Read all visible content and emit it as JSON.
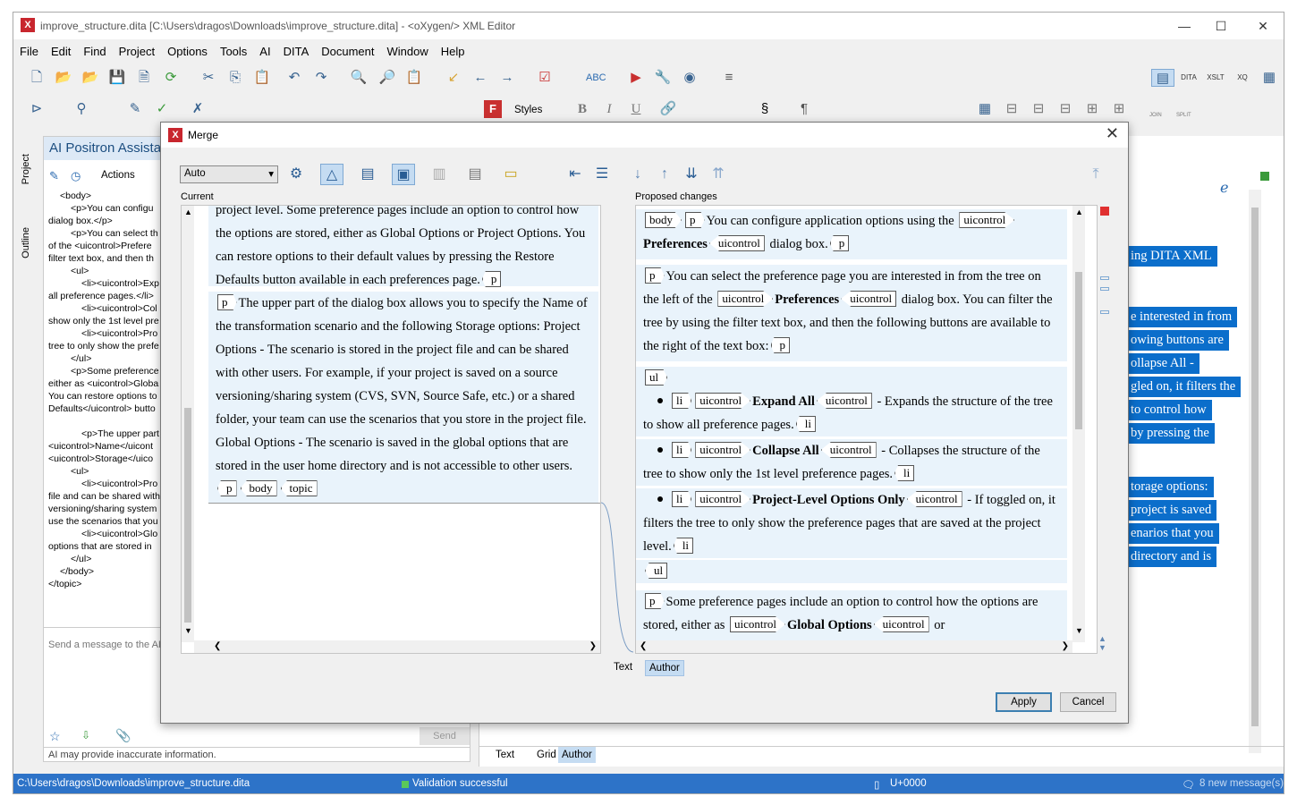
{
  "window": {
    "title": "improve_structure.dita [C:\\Users\\dragos\\Downloads\\improve_structure.dita] - <oXygen/> XML Editor",
    "logo": "X"
  },
  "menu": [
    "File",
    "Edit",
    "Find",
    "Project",
    "Options",
    "Tools",
    "AI",
    "DITA",
    "Document",
    "Window",
    "Help"
  ],
  "toolbar": {
    "styles_label": "Styles",
    "join_label": "JOIN",
    "split_label": "SPLIT"
  },
  "side_tabs": {
    "project": "Project",
    "outline": "Outline"
  },
  "ai_panel": {
    "title": "AI Positron Assista",
    "actions_label": "Actions",
    "xml_lines": [
      "<body>",
      "<p>You can configu",
      "dialog box.</p>",
      "<p>You can select th",
      "of the <uicontrol>Prefere",
      "filter text box, and then th",
      "<ul>",
      "<li><uicontrol>Exp",
      "all preference pages.</li>",
      "<li><uicontrol>Col",
      "show only the 1st level pre",
      "<li><uicontrol>Pro",
      "tree to only show the prefe",
      "</ul>",
      "<p>Some preference",
      "either as <uicontrol>Globa",
      "You can restore options to",
      "Defaults</uicontrol> butto",
      "",
      "<p>The upper part o",
      "<uicontrol>Name</uicont",
      "<uicontrol>Storage</uico",
      "<ul>",
      "<li><uicontrol>Pro",
      "file and can be shared with",
      "versioning/sharing system",
      "use the scenarios that you",
      "<li><uicontrol>Glo",
      "options that are stored in",
      "</ul>",
      "</body>",
      "</topic>"
    ],
    "input_placeholder": "Send a message to the AI",
    "send_label": "Send",
    "disclaimer": "AI may provide inaccurate information."
  },
  "editor": {
    "highlight_lines": [
      "ing DITA XML",
      "e interested in from",
      "owing buttons are",
      "ollapse All -",
      "gled on, it filters the",
      "to control how",
      "by pressing the",
      "torage options:",
      "project is saved",
      "enarios that you",
      "directory and is"
    ],
    "bottom_tabs": [
      "Text",
      "Grid",
      "Author"
    ],
    "active_tab": "Author"
  },
  "status": {
    "path": "C:\\Users\\dragos\\Downloads\\improve_structure.dita",
    "validation": "Validation successful",
    "unicode": "U+0000",
    "messages": "8 new message(s)"
  },
  "dialog": {
    "title": "Merge",
    "mode": "Auto",
    "current_label": "Current",
    "proposed_label": "Proposed changes",
    "current": {
      "top_text": "project level. Some preference pages include an option to control how the options are stored, either as Global Options or Project Options. You can restore options to their default values by pressing the Restore Defaults button available in each preferences page.",
      "para2": "The upper part of the dialog box allows you to specify the Name of the transformation scenario and the following Storage options: Project Options - The scenario is stored in the project file and can be shared with other users. For example, if your project is saved on a source versioning/sharing system (CVS, SVN, Source Safe, etc.) or a shared folder, your team can use the scenarios that you store in the project file. Global Options - The scenario is saved in the global options that are stored in the user home directory and is not accessible to other users."
    },
    "proposed": {
      "p1a": "You can configure application options using the",
      "p1b": "Preferences",
      "p1c": "dialog box.",
      "p2a": "You can select the preference page you are interested in from the tree on the left of the",
      "p2b": "Preferences",
      "p2c": "dialog box. You can filter the tree by using the filter text box, and then the following buttons are available to the right of the text box:",
      "li1a": "Expand All",
      "li1b": "- Expands the structure of the tree to show all preference pages.",
      "li2a": "Collapse All",
      "li2b": "- Collapses the structure of the tree to show only the 1st level preference pages.",
      "li3a": "Project-Level Options Only",
      "li3b": "- If toggled on, it filters the tree to only show the preference pages that are saved at the project level.",
      "p3a": "Some preference pages include an option to control how the options are stored, either as",
      "p3b": "Global Options",
      "p3c": "or"
    },
    "tags": {
      "body": "body",
      "p": "p",
      "ul": "ul",
      "li": "li",
      "uicontrol": "uicontrol",
      "topic": "topic"
    },
    "bottom_tabs": [
      "Text",
      "Author"
    ],
    "active_tab": "Author",
    "apply_label": "Apply",
    "cancel_label": "Cancel"
  }
}
